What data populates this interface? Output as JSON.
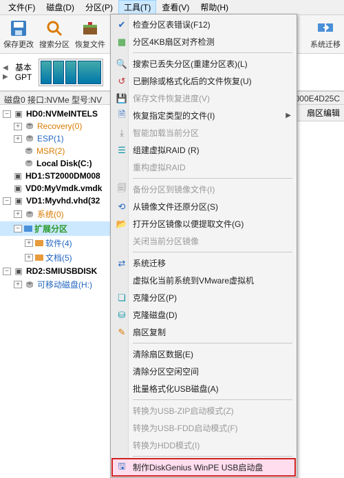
{
  "menubar": {
    "file": "文件(F)",
    "disk": "磁盘(D)",
    "partition": "分区(P)",
    "tools": "工具(T)",
    "view": "查看(V)",
    "help": "帮助(H)"
  },
  "toolbar": {
    "save": "保存更改",
    "search": "搜索分区",
    "recover": "恢复文件",
    "sysmig": "系统迁移"
  },
  "diskbar": {
    "basic": "基本",
    "gpt": "GPT"
  },
  "status": {
    "left": "磁盘0 接口:NVMe 型号:NV",
    "right": "000E4D25C"
  },
  "right_panel": {
    "header": "扇区编辑"
  },
  "tree": {
    "hd0": "HD0:NVMeINTELS",
    "recovery": "Recovery(0)",
    "esp": "ESP(1)",
    "msr": "MSR(2)",
    "localc": "Local Disk(C:)",
    "hd1": "HD1:ST2000DM008",
    "vd0": "VD0:MyVmdk.vmdk",
    "vd1": "VD1:Myvhd.vhd(32",
    "sys0": "系统(0)",
    "ext": "扩展分区",
    "soft4": "软件(4)",
    "doc5": "文档(5)",
    "rd2": "RD2:SMIUSBDISK",
    "removable": "可移动磁盘(H:)"
  },
  "menu": {
    "check_err": "检查分区表错误(F12)",
    "align4k": "分区4KB扇区对齐检测",
    "search_lost": "搜索已丢失分区(重建分区表)(L)",
    "recover_del": "已删除或格式化后的文件恢复(U)",
    "save_progress": "保存文件恢复进度(V)",
    "recover_type": "恢复指定类型的文件(I)",
    "smart_load": "智能加载当前分区",
    "build_raid": "组建虚拟RAID  (R)",
    "restruct_raid": "重构虚拟RAID",
    "backup_img": "备份分区到镜像文件(I)",
    "restore_img": "从镜像文件还原分区(S)",
    "open_img": "打开分区镜像以便提取文件(G)",
    "close_img": "关闭当前分区镜像",
    "sys_migrate": "系统迁移",
    "vmware": "虚拟化当前系统到VMware虚拟机",
    "clone_part": "克隆分区(P)",
    "clone_disk": "克隆磁盘(D)",
    "sector_copy": "扇区复制",
    "clear_sector": "清除扇区数据(E)",
    "clear_free": "清除分区空闲空间",
    "batch_usb": "批量格式化USB磁盘(A)",
    "usb_zip": "转换为USB-ZIP启动模式(Z)",
    "usb_fdd": "转换为USB-FDD启动模式(F)",
    "to_hdd": "转换为HDD模式(I)",
    "make_winpe": "制作DiskGenius WinPE USB启动盘"
  }
}
